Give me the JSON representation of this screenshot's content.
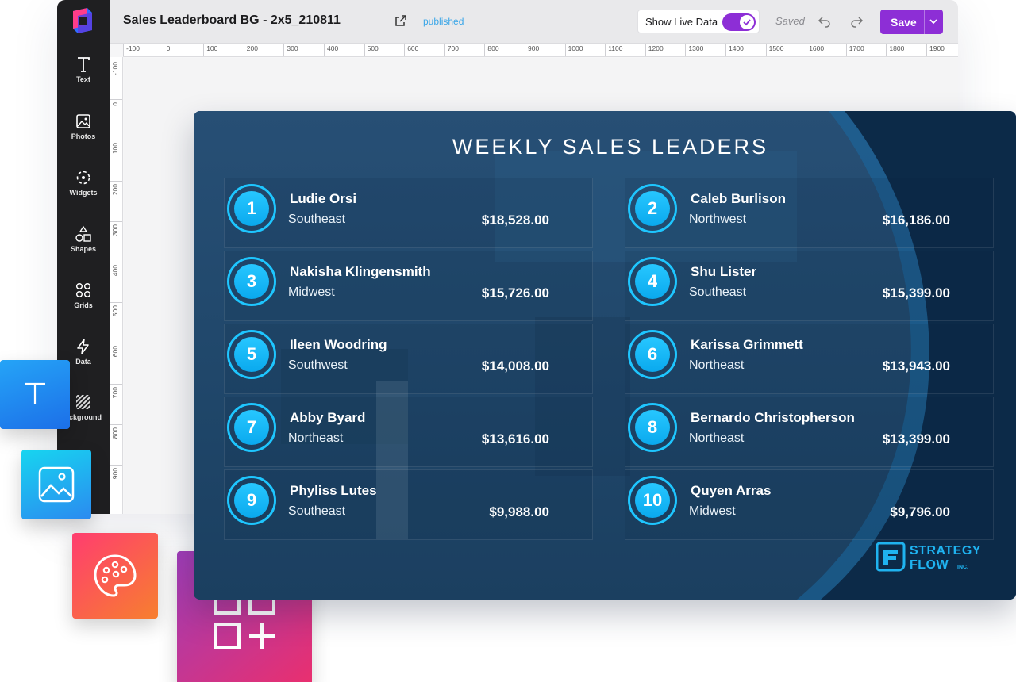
{
  "editor": {
    "doc_title": "Sales Leaderboard BG - 2x5_210811",
    "status": "published",
    "live_data_label": "Show Live Data",
    "live_data_on": true,
    "saved_label": "Saved",
    "save_label": "Save",
    "accent_color": "#8d2ed6"
  },
  "sidebar": {
    "items": [
      {
        "label": "Text",
        "icon": "text-icon"
      },
      {
        "label": "Photos",
        "icon": "photo-icon"
      },
      {
        "label": "Widgets",
        "icon": "widgets-icon"
      },
      {
        "label": "Shapes",
        "icon": "shapes-icon"
      },
      {
        "label": "Grids",
        "icon": "grids-icon"
      },
      {
        "label": "Data",
        "icon": "lightning-icon"
      },
      {
        "label": "ackground",
        "icon": "background-icon"
      }
    ]
  },
  "ruler": {
    "horizontal": [
      "-100",
      "0",
      "100",
      "200",
      "300",
      "400",
      "500",
      "600",
      "700",
      "800",
      "900",
      "1000",
      "1100",
      "1200",
      "1300",
      "1400",
      "1500",
      "1600",
      "1700",
      "1800",
      "1900"
    ],
    "vertical": [
      "-100",
      "0",
      "100",
      "200",
      "300",
      "400",
      "500",
      "600",
      "700",
      "800",
      "900"
    ]
  },
  "tiles": [
    {
      "name": "text-tile",
      "icon": "text-icon"
    },
    {
      "name": "photo-tile",
      "icon": "image-icon"
    },
    {
      "name": "palette-tile",
      "icon": "palette-icon"
    },
    {
      "name": "grid-add-tile",
      "icon": "grid-add-icon"
    }
  ],
  "leaderboard": {
    "title": "WEEKLY SALES LEADERS",
    "leaders": [
      {
        "rank": "1",
        "name": "Ludie Orsi",
        "region": "Southeast",
        "amount": "$18,528.00"
      },
      {
        "rank": "2",
        "name": "Caleb Burlison",
        "region": "Northwest",
        "amount": "$16,186.00"
      },
      {
        "rank": "3",
        "name": "Nakisha Klingensmith",
        "region": "Midwest",
        "amount": "$15,726.00"
      },
      {
        "rank": "4",
        "name": "Shu Lister",
        "region": "Southeast",
        "amount": "$15,399.00"
      },
      {
        "rank": "5",
        "name": "Ileen Woodring",
        "region": "Southwest",
        "amount": "$14,008.00"
      },
      {
        "rank": "6",
        "name": "Karissa Grimmett",
        "region": "Northeast",
        "amount": "$13,943.00"
      },
      {
        "rank": "7",
        "name": "Abby Byard",
        "region": "Northeast",
        "amount": "$13,616.00"
      },
      {
        "rank": "8",
        "name": "Bernardo Christopherson",
        "region": "Northeast",
        "amount": "$13,399.00"
      },
      {
        "rank": "9",
        "name": "Phyliss Lutes",
        "region": "Southeast",
        "amount": "$9,988.00"
      },
      {
        "rank": "10",
        "name": "Quyen Arras",
        "region": "Midwest",
        "amount": "$9,796.00"
      }
    ],
    "brand": {
      "line1": "STRATEGY",
      "line2": "FLOW",
      "suffix": "INC."
    },
    "accent_color": "#1ec6ff"
  }
}
